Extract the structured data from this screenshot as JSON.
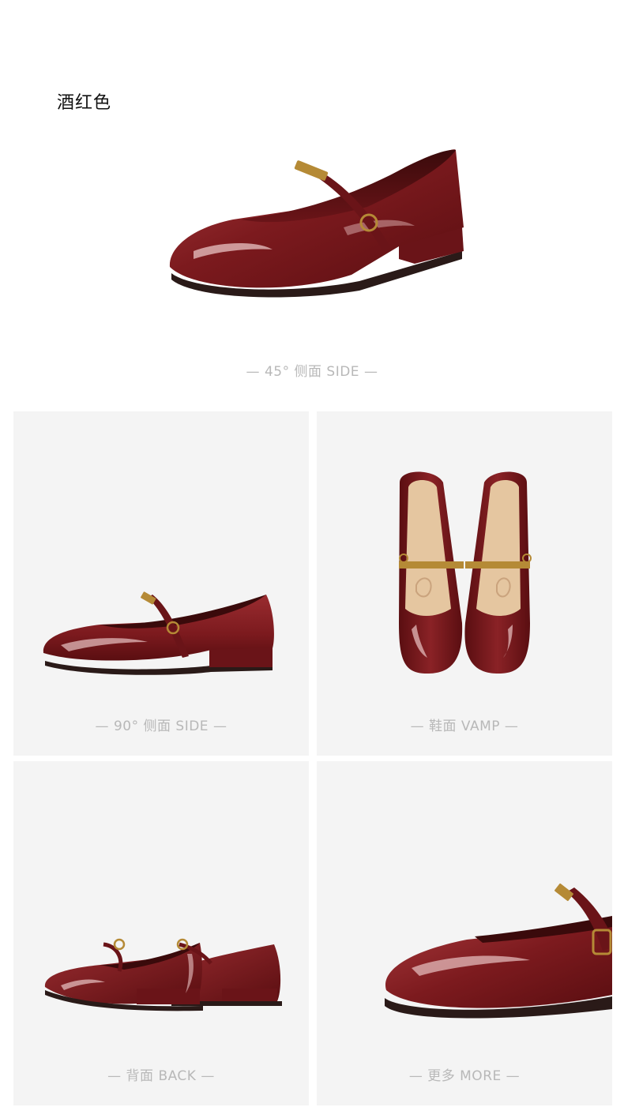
{
  "header": {
    "color_name": "酒红色"
  },
  "views": [
    {
      "id": "side45",
      "caption": "— 45°  侧面 SIDE —"
    },
    {
      "id": "side90",
      "caption": "—  90°  侧面 SIDE  —"
    },
    {
      "id": "vamp",
      "caption": "— 鞋面 VAMP —"
    },
    {
      "id": "back",
      "caption": "— 背面 BACK —"
    },
    {
      "id": "more",
      "caption": "— 更多 MORE —"
    }
  ],
  "colors": {
    "leather_dark": "#5e0f12",
    "leather_mid": "#7c1a1e",
    "leather_light": "#a7383b",
    "highlight": "#e9c4c4",
    "gold": "#b58a36",
    "insole": "#e5c6a0",
    "sole": "#2a1a18",
    "tile_bg": "#f4f4f4",
    "caption": "#b8b8b8"
  }
}
